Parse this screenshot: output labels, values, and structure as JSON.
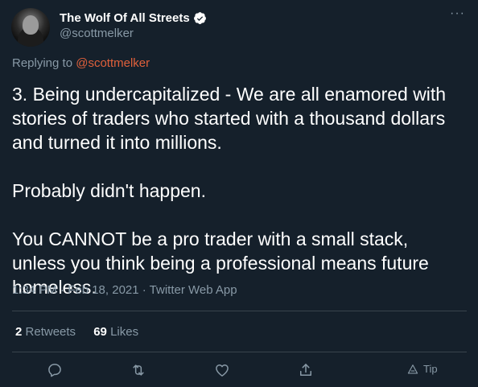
{
  "author": {
    "display_name": "The Wolf Of All Streets",
    "handle": "@scottmelker",
    "verified_icon": "verified-badge-icon"
  },
  "reply": {
    "prefix": "Replying to ",
    "mention": "@scottmelker"
  },
  "tweet": {
    "lines": [
      "3. Being undercapitalized - We are all enamored with stories of traders who started with a thousand dollars and turned it into millions.",
      "Probably didn't happen.",
      "You CANNOT be a pro trader with a small stack, unless you think being a professional means future homeless."
    ]
  },
  "meta": {
    "time": "1:34 PM",
    "date": "Feb 18, 2021",
    "client": "Twitter Web App",
    "text": "1:34 PM · Feb 18, 2021 · Twitter Web App"
  },
  "stats": {
    "retweets_count": "2",
    "retweets_label": "Retweets",
    "likes_count": "69",
    "likes_label": "Likes"
  },
  "actions": {
    "tip_label": "Tip"
  },
  "colors": {
    "background": "#15202b",
    "secondary_text": "#8899a6",
    "mention": "#e0603b",
    "divider": "#38444d"
  }
}
